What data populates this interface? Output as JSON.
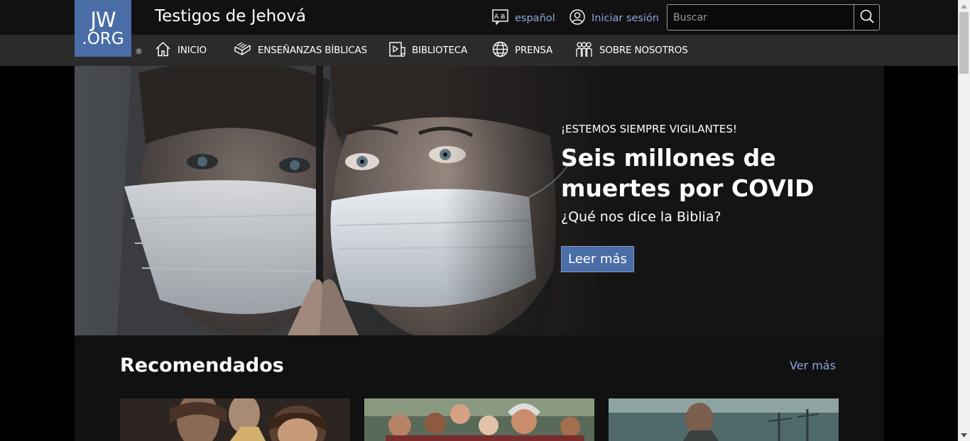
{
  "header": {
    "logo_line1": "JW",
    "logo_line2": ".ORG",
    "registered": "®",
    "site_title": "Testigos de Jehová",
    "language_label": "español",
    "login_label": "Iniciar sesión",
    "search_placeholder": "Buscar"
  },
  "nav": {
    "items": [
      {
        "label": "INICIO",
        "icon": "home-icon"
      },
      {
        "label": "ENSEÑANZAS BÍBLICAS",
        "icon": "open-bible-icon"
      },
      {
        "label": "BIBLIOTECA",
        "icon": "library-media-icon"
      },
      {
        "label": "PRENSA",
        "icon": "globe-icon"
      },
      {
        "label": "SOBRE NOSOTROS",
        "icon": "people-icon"
      }
    ]
  },
  "hero": {
    "eyebrow": "¡ESTEMOS SIEMPRE VIGILANTES!",
    "title": "Seis millones de muertes por COVID",
    "subtitle": "¿Qué nos dice la Biblia?",
    "button_label": "Leer más"
  },
  "recommended": {
    "title": "Recomendados",
    "see_more": "Ver más"
  },
  "colors": {
    "brand_blue": "#4a6da7",
    "link_blue": "#8aa8dc",
    "topbar": "#111111",
    "navbar": "#2b2b2b"
  }
}
